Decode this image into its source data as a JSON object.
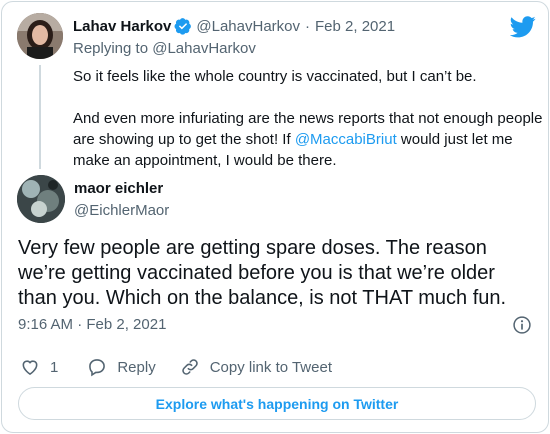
{
  "parent_tweet": {
    "display_name": "Lahav Harkov",
    "handle": "@LahavHarkov",
    "separator": "·",
    "date": "Feb 2, 2021",
    "replying_to_prefix": "Replying to ",
    "replying_to_handle": "@LahavHarkov",
    "paragraph1": "So it feels like the whole country is vaccinated, but I can’t be.",
    "paragraph2_before": "And even more infuriating are the news reports that not enough people are showing up to get the shot! If ",
    "paragraph2_mention": "@MaccabiBriut",
    "paragraph2_after": " would just let me make an appointment, I would be there."
  },
  "reply_tweet": {
    "display_name": "maor eichler",
    "handle": "@EichlerMaor",
    "text": "Very few people are getting spare doses. The reason we’re getting vaccinated before you is that we’re older than you. Which on the balance, is not THAT much fun.",
    "timestamp": "9:16 AM · Feb 2, 2021"
  },
  "actions": {
    "like_count": "1",
    "reply_label": "Reply",
    "copy_link_label": "Copy link to Tweet"
  },
  "explore_label": "Explore what's happening on Twitter",
  "colors": {
    "brand_blue": "#1d9bf0",
    "muted_text": "#536471",
    "like_red_icon": "#f91880"
  },
  "icons": [
    "twitter-bird-icon",
    "verified-badge-icon",
    "info-icon",
    "heart-icon",
    "reply-bubble-icon",
    "link-icon"
  ]
}
